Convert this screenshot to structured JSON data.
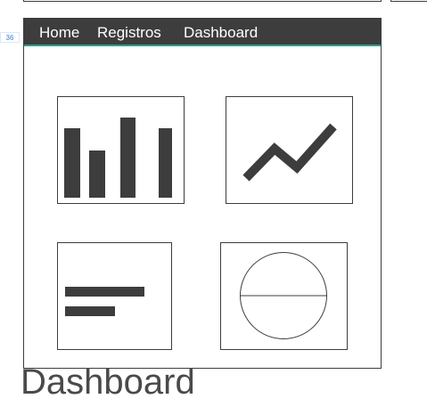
{
  "gutter": {
    "line_number": "36"
  },
  "nav": {
    "links": [
      {
        "label": "Home"
      },
      {
        "label": "Registros"
      },
      {
        "label": "Dashboard"
      }
    ]
  },
  "tiles": [
    {
      "icon": "bar-chart-icon"
    },
    {
      "icon": "line-chart-icon"
    },
    {
      "icon": "horizontal-bar-chart-icon"
    },
    {
      "icon": "pie-chart-icon"
    }
  ],
  "page": {
    "heading": "Dashboard"
  },
  "colors": {
    "nav_background": "#3d3d3d",
    "nav_accent": "#1aa88e",
    "icon": "#3d3d3d",
    "heading": "#4a4a4a"
  }
}
